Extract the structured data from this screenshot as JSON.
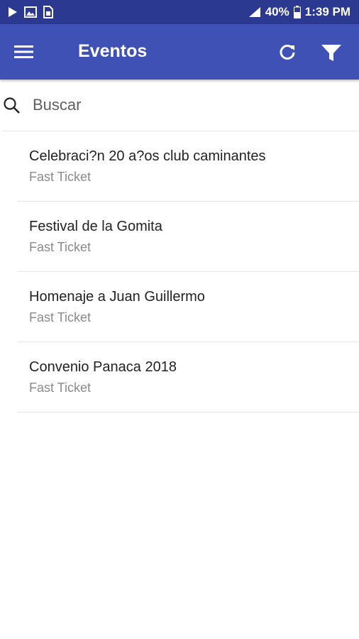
{
  "status_bar": {
    "battery": "40%",
    "time": "1:39 PM",
    "icons": [
      "play-store-icon",
      "image-icon",
      "sim-alert-icon",
      "signal-icon",
      "battery-icon"
    ]
  },
  "app_bar": {
    "title": "Eventos",
    "background_color": "#3f51b5",
    "status_color": "#2c3990",
    "icons": [
      "menu-icon",
      "refresh-icon",
      "filter-icon"
    ]
  },
  "search": {
    "placeholder": "Buscar",
    "value": ""
  },
  "events": [
    {
      "title": "Celebraci?n 20 a?os club caminantes",
      "subtitle": "Fast Ticket"
    },
    {
      "title": "Festival de la Gomita",
      "subtitle": "Fast Ticket"
    },
    {
      "title": "Homenaje a Juan Guillermo",
      "subtitle": "Fast Ticket"
    },
    {
      "title": "Convenio Panaca 2018",
      "subtitle": "Fast Ticket"
    }
  ]
}
